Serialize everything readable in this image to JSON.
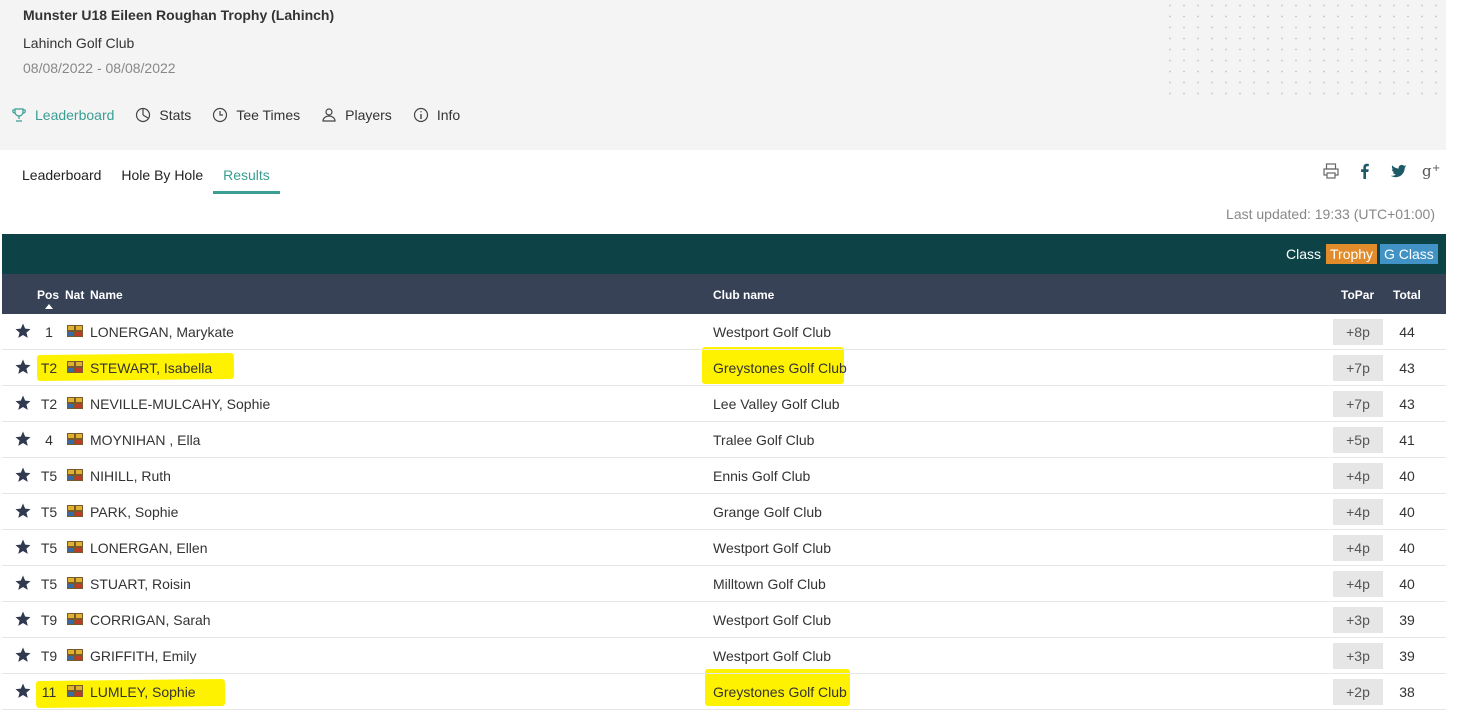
{
  "header": {
    "title": "Munster U18 Eileen Roughan Trophy (Lahinch)",
    "club": "Lahinch Golf Club",
    "dates": "08/08/2022 - 08/08/2022"
  },
  "top_nav": [
    {
      "label": "Leaderboard",
      "icon": "trophy-icon",
      "active": true
    },
    {
      "label": "Stats",
      "icon": "pie-chart-icon"
    },
    {
      "label": "Tee Times",
      "icon": "clock-icon"
    },
    {
      "label": "Players",
      "icon": "user-icon"
    },
    {
      "label": "Info",
      "icon": "info-icon"
    }
  ],
  "sub_tabs": [
    {
      "label": "Leaderboard"
    },
    {
      "label": "Hole By Hole"
    },
    {
      "label": "Results",
      "active": true
    }
  ],
  "share": [
    "print-icon",
    "facebook-icon",
    "twitter-icon",
    "google-plus-icon"
  ],
  "last_updated": "Last updated: 19:33 (UTC+01:00)",
  "class_bar": {
    "label": "Class",
    "badges": [
      {
        "label": "Trophy",
        "color": "#e28b2a"
      },
      {
        "label": "G Class",
        "color": "#4193c6"
      }
    ]
  },
  "columns": {
    "pos": "Pos",
    "nat": "Nat",
    "name": "Name",
    "club": "Club name",
    "topar": "ToPar",
    "total": "Total"
  },
  "rows": [
    {
      "pos": "1",
      "name": "LONERGAN, Marykate",
      "club": "Westport Golf Club",
      "topar": "+8p",
      "total": "44"
    },
    {
      "pos": "T2",
      "name": "STEWART, Isabella",
      "club": "Greystones Golf Club",
      "topar": "+7p",
      "total": "43"
    },
    {
      "pos": "T2",
      "name": "NEVILLE-MULCAHY, Sophie",
      "club": "Lee Valley Golf Club",
      "topar": "+7p",
      "total": "43"
    },
    {
      "pos": "4",
      "name": "MOYNIHAN , Ella",
      "club": "Tralee Golf Club",
      "topar": "+5p",
      "total": "41"
    },
    {
      "pos": "T5",
      "name": "NIHILL, Ruth",
      "club": "Ennis Golf Club",
      "topar": "+4p",
      "total": "40"
    },
    {
      "pos": "T5",
      "name": "PARK, Sophie",
      "club": "Grange Golf Club",
      "topar": "+4p",
      "total": "40"
    },
    {
      "pos": "T5",
      "name": "LONERGAN, Ellen",
      "club": "Westport Golf Club",
      "topar": "+4p",
      "total": "40"
    },
    {
      "pos": "T5",
      "name": "STUART, Roisin",
      "club": "Milltown Golf Club",
      "topar": "+4p",
      "total": "40"
    },
    {
      "pos": "T9",
      "name": "CORRIGAN, Sarah",
      "club": "Westport Golf Club",
      "topar": "+3p",
      "total": "39"
    },
    {
      "pos": "T9",
      "name": "GRIFFITH, Emily",
      "club": "Westport Golf Club",
      "topar": "+3p",
      "total": "39"
    },
    {
      "pos": "11",
      "name": "LUMLEY, Sophie",
      "club": "Greystones Golf Club",
      "topar": "+2p",
      "total": "38"
    }
  ],
  "colors": {
    "accent": "#3a9e93",
    "class_bar_bg": "#0d4347",
    "column_header_bg": "#374257",
    "highlight": "#fff200"
  }
}
